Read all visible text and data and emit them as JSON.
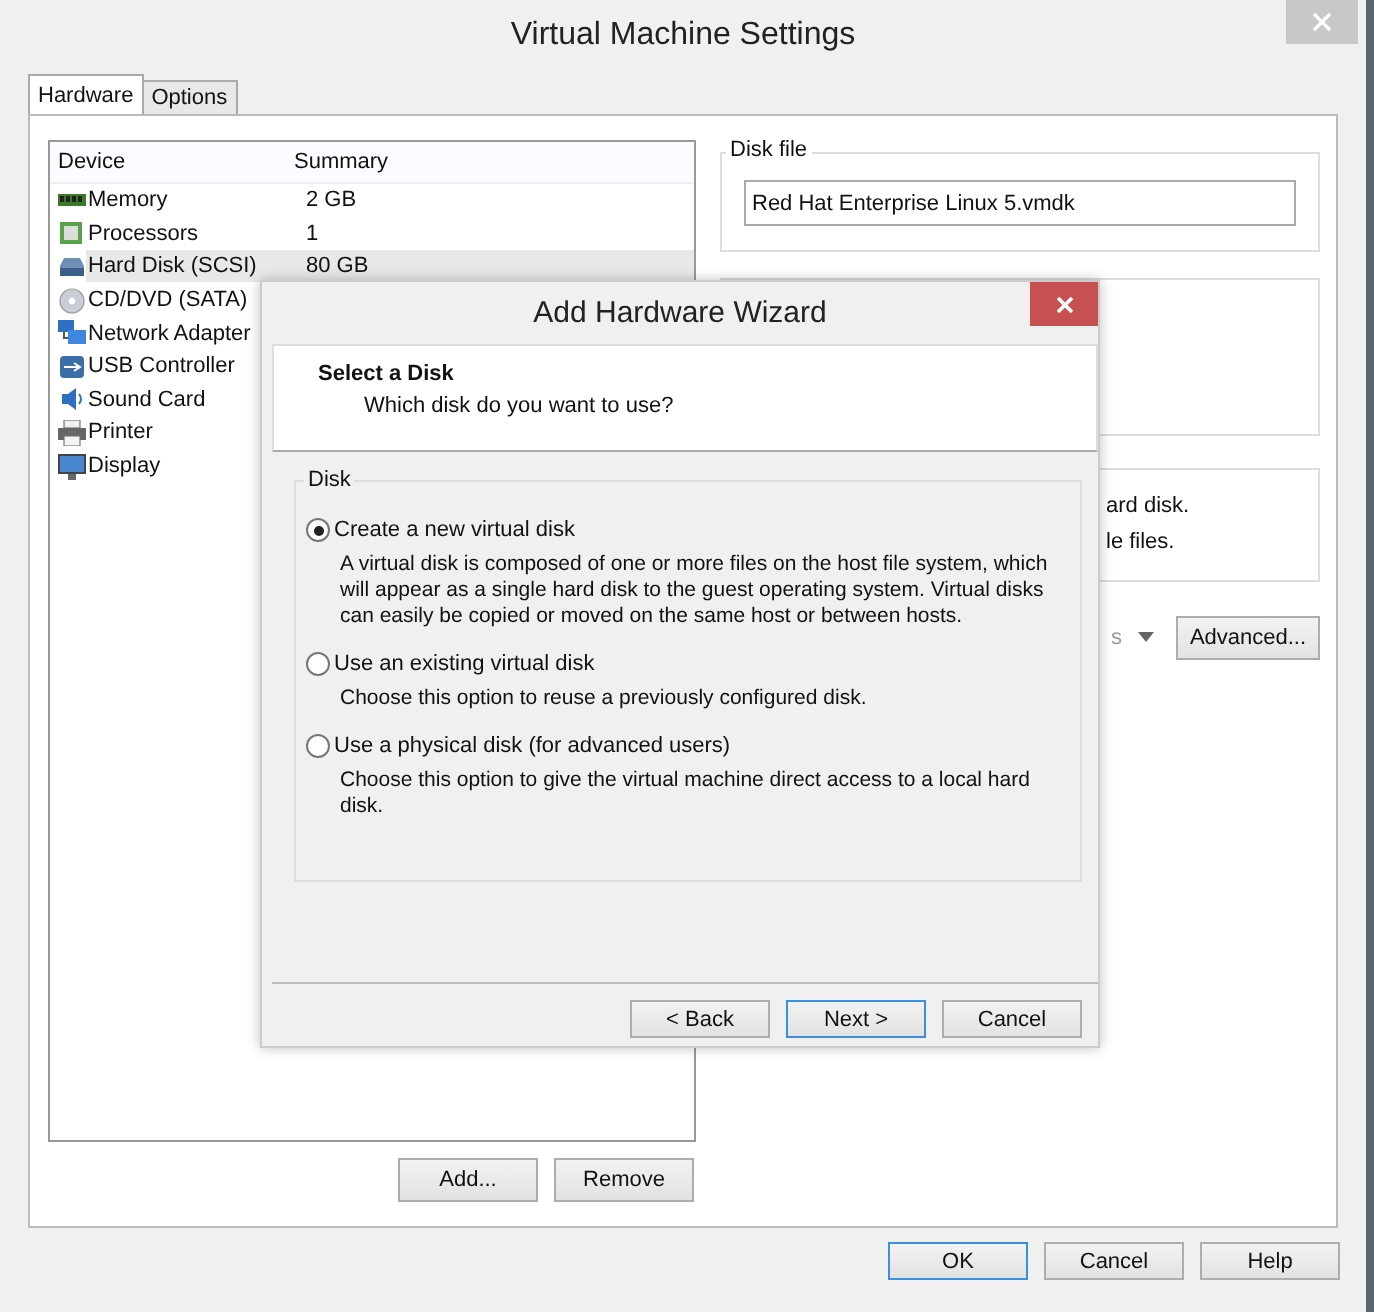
{
  "window": {
    "title": "Virtual Machine Settings"
  },
  "tabs": [
    {
      "label": "Hardware",
      "selected": true
    },
    {
      "label": "Options",
      "selected": false
    }
  ],
  "device_list": {
    "columns": [
      "Device",
      "Summary"
    ],
    "rows": [
      {
        "kind": "memory",
        "device": "Memory",
        "summary": "2 GB",
        "selected": false
      },
      {
        "kind": "processor",
        "device": "Processors",
        "summary": "1",
        "selected": false
      },
      {
        "kind": "harddisk",
        "device": "Hard Disk (SCSI)",
        "summary": "80 GB",
        "selected": true
      },
      {
        "kind": "cdrom",
        "device": "CD/DVD (SATA)",
        "summary": "",
        "selected": false
      },
      {
        "kind": "network",
        "device": "Network Adapter",
        "summary": "",
        "selected": false
      },
      {
        "kind": "usb",
        "device": "USB Controller",
        "summary": "",
        "selected": false
      },
      {
        "kind": "sound",
        "device": "Sound Card",
        "summary": "",
        "selected": false
      },
      {
        "kind": "printer",
        "device": "Printer",
        "summary": "",
        "selected": false
      },
      {
        "kind": "display",
        "device": "Display",
        "summary": "",
        "selected": false
      }
    ]
  },
  "list_buttons": [
    "Add...",
    "Remove"
  ],
  "disk_file": {
    "legend": "Disk file",
    "value": "Red Hat Enterprise Linux 5.vmdk"
  },
  "info_fragments": [
    "ard disk.",
    "le files."
  ],
  "utilities_dropdown": {
    "value": "s"
  },
  "advanced_button": "Advanced...",
  "dialog_buttons": [
    {
      "label": "OK",
      "default": true
    },
    {
      "label": "Cancel",
      "default": false
    },
    {
      "label": "Help",
      "default": false
    }
  ],
  "wizard": {
    "title": "Add Hardware Wizard",
    "heading": "Select a Disk",
    "subheading": "Which disk do you want to use?",
    "group": "Disk",
    "options": [
      {
        "label": "Create a new virtual disk",
        "description": "A virtual disk is composed of one or more files on the host file system, which will appear as a single hard disk to the guest operating system. Virtual disks can easily be copied or moved on the same host or between hosts.",
        "selected": true
      },
      {
        "label": "Use an existing virtual disk",
        "description": "Choose this option to reuse a previously configured disk.",
        "selected": false
      },
      {
        "label": "Use a physical disk (for advanced users)",
        "description": "Choose this option to give the virtual machine direct access to a local hard disk.",
        "selected": false
      }
    ],
    "buttons": [
      {
        "label": "< Back",
        "default": false
      },
      {
        "label": "Next >",
        "default": true
      },
      {
        "label": "Cancel",
        "default": false
      }
    ]
  }
}
